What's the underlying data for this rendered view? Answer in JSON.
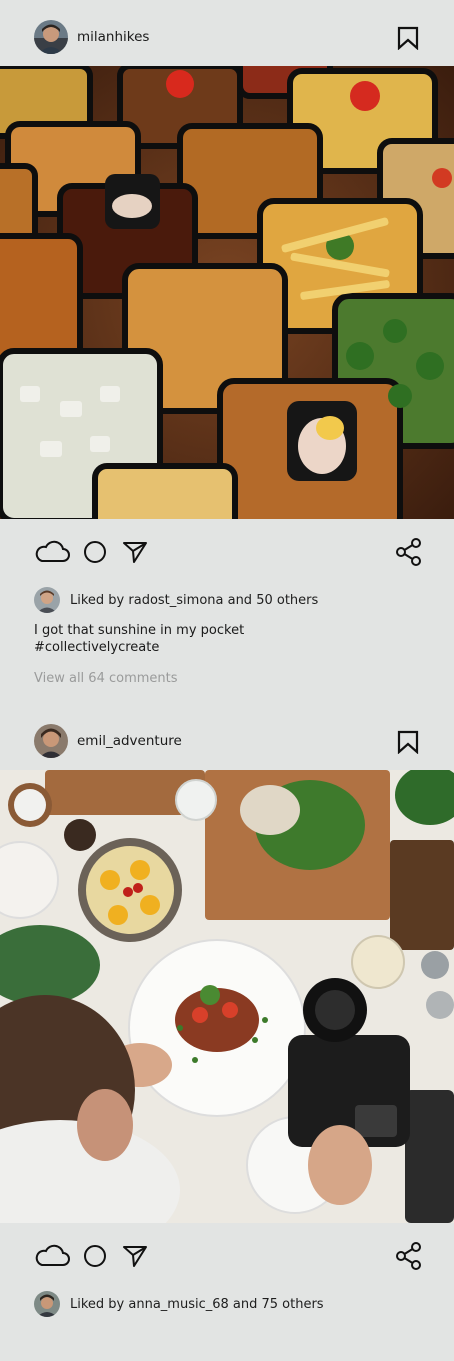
{
  "posts": [
    {
      "username": "milanhikes",
      "avatar_icon": "user-avatar",
      "image_alt": "",
      "likes_text": "Liked by radost_simona and 50 others",
      "caption_line1": "I got that sunshine in my pocket",
      "caption_line2": "#collectivelycreate",
      "comments_link": "View all 64 comments"
    },
    {
      "username": "emil_adventure",
      "avatar_icon": "user-avatar",
      "image_alt": "",
      "likes_text": "Liked by anna_music_68 and 75 others"
    }
  ],
  "icons": {
    "like": "cloud-icon",
    "comment": "circle-icon",
    "send": "send-icon",
    "share": "share-icon",
    "bookmark": "bookmark-icon"
  },
  "colors": {
    "background": "#e2e4e3",
    "text": "#1d1d1d",
    "muted": "#9a9b9b"
  }
}
